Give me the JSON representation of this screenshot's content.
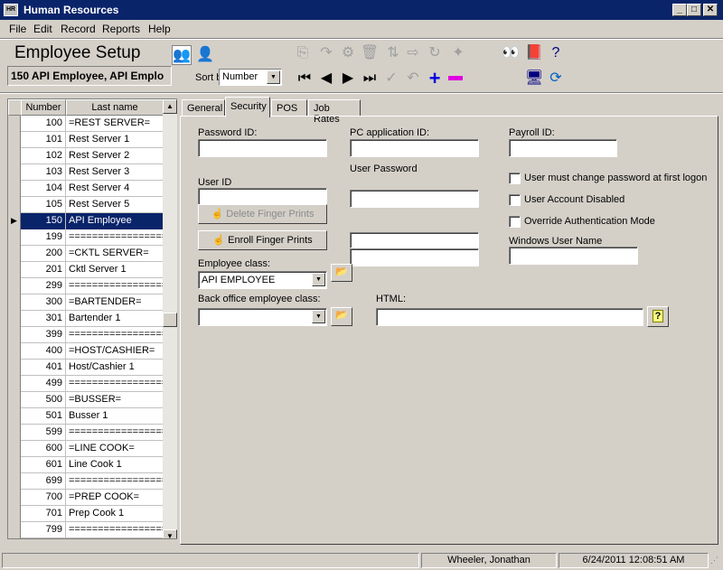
{
  "window": {
    "title": "Human Resources",
    "icon_text": "HR"
  },
  "menu": [
    "File",
    "Edit",
    "Record",
    "Reports",
    "Help"
  ],
  "header": {
    "page_title": "Employee Setup",
    "current_employee": "150  API Employee, API Emplo"
  },
  "sort": {
    "label": "Sort by:",
    "value": "Number"
  },
  "list": {
    "columns": [
      "Number",
      "Last name"
    ],
    "rows": [
      {
        "number": "100",
        "name": "=REST SERVER="
      },
      {
        "number": "101",
        "name": "Rest Server 1"
      },
      {
        "number": "102",
        "name": "Rest Server 2"
      },
      {
        "number": "103",
        "name": "Rest Server 3"
      },
      {
        "number": "104",
        "name": "Rest Server 4"
      },
      {
        "number": "105",
        "name": "Rest Server 5"
      },
      {
        "number": "150",
        "name": "API Employee",
        "selected": true
      },
      {
        "number": "199",
        "name": "=================="
      },
      {
        "number": "200",
        "name": "=CKTL SERVER="
      },
      {
        "number": "201",
        "name": "Cktl Server 1"
      },
      {
        "number": "299",
        "name": "=================="
      },
      {
        "number": "300",
        "name": "=BARTENDER="
      },
      {
        "number": "301",
        "name": "Bartender 1"
      },
      {
        "number": "399",
        "name": "=================="
      },
      {
        "number": "400",
        "name": "=HOST/CASHIER="
      },
      {
        "number": "401",
        "name": "Host/Cashier 1"
      },
      {
        "number": "499",
        "name": "=================="
      },
      {
        "number": "500",
        "name": "=BUSSER="
      },
      {
        "number": "501",
        "name": "Busser 1"
      },
      {
        "number": "599",
        "name": "=================="
      },
      {
        "number": "600",
        "name": "=LINE COOK="
      },
      {
        "number": "601",
        "name": "Line Cook 1"
      },
      {
        "number": "699",
        "name": "=================="
      },
      {
        "number": "700",
        "name": "=PREP COOK="
      },
      {
        "number": "701",
        "name": "Prep Cook 1"
      },
      {
        "number": "799",
        "name": "=================="
      }
    ]
  },
  "tabs": [
    "General",
    "Security",
    "POS",
    "Job Rates"
  ],
  "security": {
    "password_id_label": "Password ID:",
    "pc_app_id_label": "PC application ID:",
    "payroll_id_label": "Payroll ID:",
    "user_id_label": "User ID",
    "user_password_label": "User Password",
    "delete_fp_label": "Delete Finger Prints",
    "enroll_fp_label": "Enroll Finger Prints",
    "chk_change_password": "User must change password at first logon",
    "chk_disabled": "User Account Disabled",
    "chk_override_auth": "Override Authentication Mode",
    "windows_user_label": "Windows User Name",
    "employee_class_label": "Employee class:",
    "employee_class_value": "API EMPLOYEE",
    "back_office_label": "Back office employee class:",
    "back_office_value": "",
    "html_label": "HTML:",
    "html_value": ""
  },
  "status": {
    "user": "Wheeler, Jonathan",
    "datetime": "6/24/2011 12:08:51 AM"
  }
}
